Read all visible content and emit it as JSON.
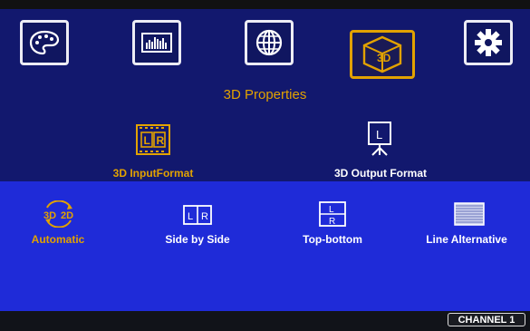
{
  "menu": {
    "icons": [
      {
        "name": "palette-icon",
        "active": false
      },
      {
        "name": "signal-bars-icon",
        "active": false
      },
      {
        "name": "globe-icon",
        "active": false
      },
      {
        "name": "3d-cube-icon",
        "active": true
      },
      {
        "name": "gear-icon",
        "active": false
      }
    ],
    "title": "3D Properties"
  },
  "formats": {
    "input_label": "3D InputFormat",
    "output_label": "3D Output Format",
    "input_icon_text": [
      "L",
      "R"
    ],
    "output_icon_text": "L"
  },
  "modes": {
    "automatic_label": "Automatic",
    "automatic_icon_text": [
      "3D",
      "2D"
    ],
    "side_by_side_label": "Side by Side",
    "side_by_side_icon_text": [
      "L",
      "R"
    ],
    "top_bottom_label": "Top-bottom",
    "top_bottom_icon_text": [
      "L",
      "R"
    ],
    "line_alternative_label": "Line Alternative"
  },
  "status": {
    "channel": "CHANNEL 1"
  },
  "colors": {
    "accent": "#e2a200",
    "upper_bg": "#12186e",
    "lower_bg": "#1f2bd8",
    "text": "#ffffff"
  }
}
